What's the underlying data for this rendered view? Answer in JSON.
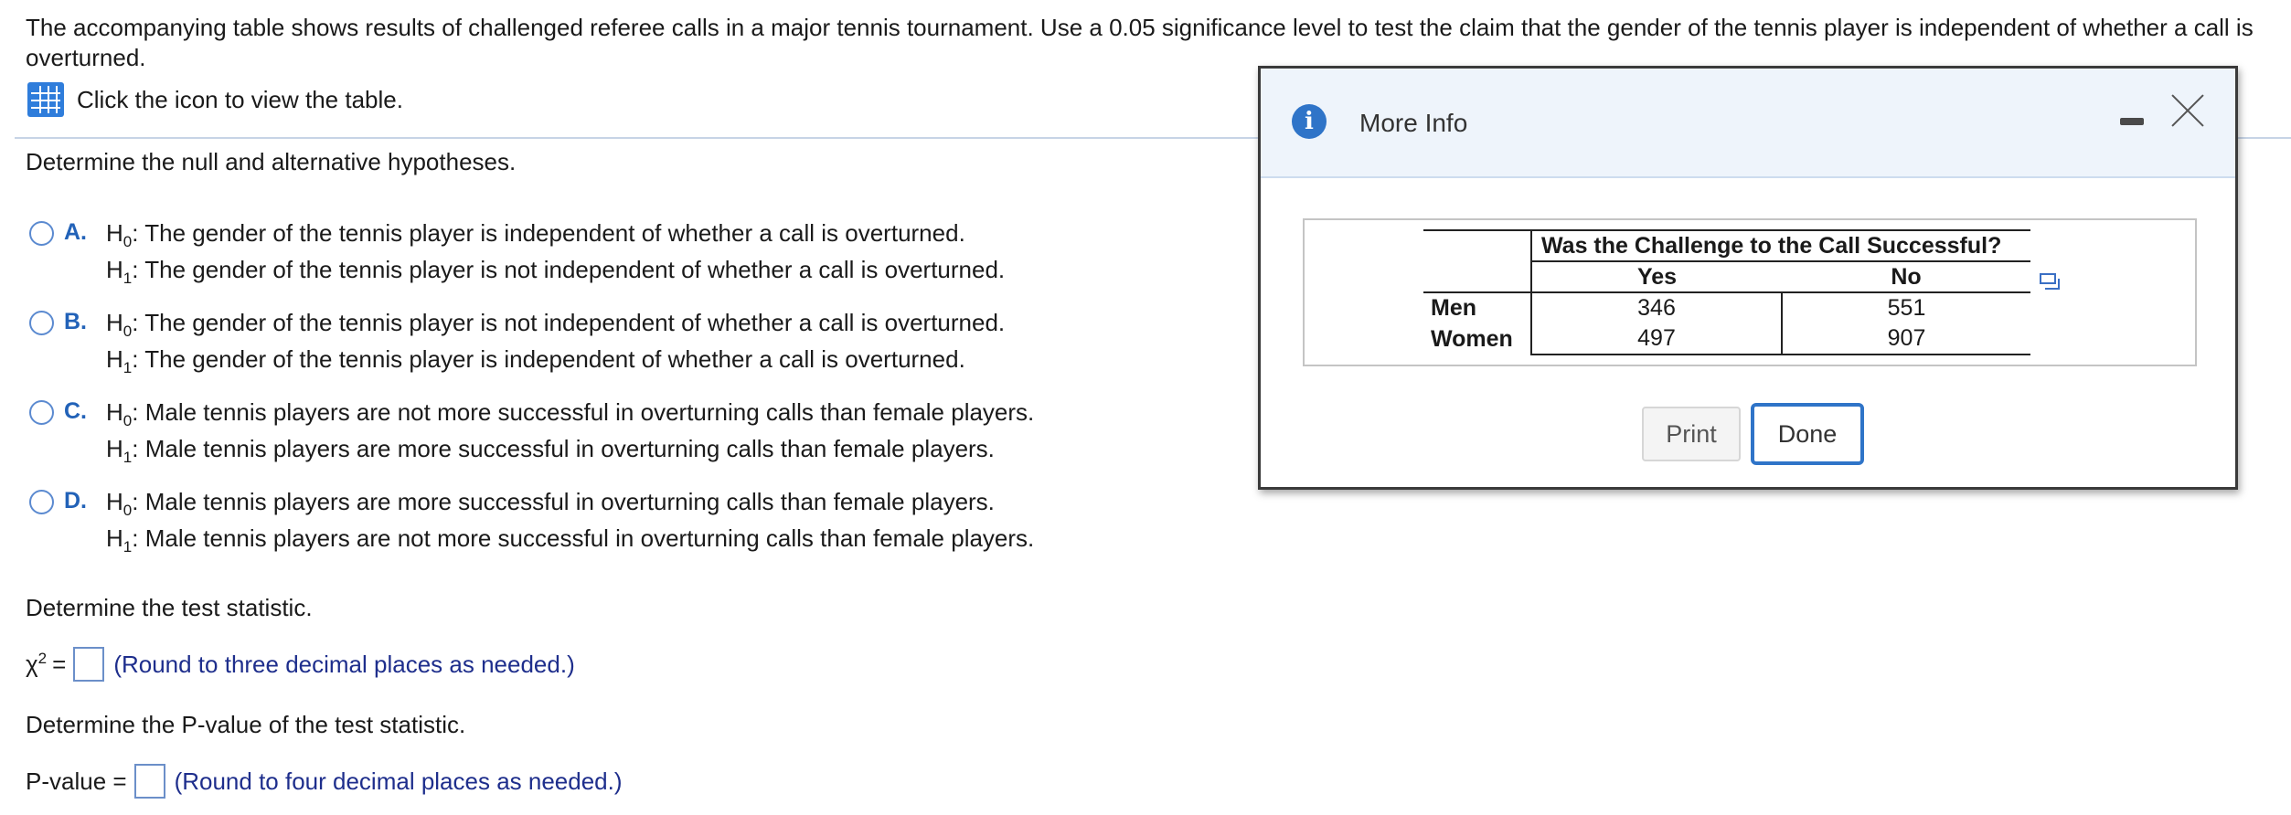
{
  "problem": {
    "text": "The accompanying table shows results of challenged referee calls in a major tennis tournament. Use a 0.05 significance level to test the claim that the gender of the tennis player is independent of whether a call is overturned.",
    "view_table_label": "Click the icon to view the table."
  },
  "hypotheses": {
    "prompt": "Determine the null and alternative hypotheses.",
    "h0_symbol": "H",
    "h0_sub": "0",
    "h1_symbol": "H",
    "h1_sub": "1",
    "options": [
      {
        "letter": "A.",
        "h0": ": The gender of the tennis player is independent of whether a call is overturned.",
        "h1": ": The gender of the tennis player is not independent of whether a call is overturned."
      },
      {
        "letter": "B.",
        "h0": ": The gender of the tennis player is not independent of whether a call is overturned.",
        "h1": ": The gender of the tennis player is independent of whether a call is overturned."
      },
      {
        "letter": "C.",
        "h0": ": Male tennis players are not more successful in overturning calls than female players.",
        "h1": ": Male tennis players are more successful in overturning calls than female players."
      },
      {
        "letter": "D.",
        "h0": ": Male tennis players are more successful in overturning calls than female players.",
        "h1": ": Male tennis players are not more successful in overturning calls than female players."
      }
    ]
  },
  "test_statistic": {
    "prompt": "Determine the test statistic.",
    "symbol": "χ",
    "exponent": "2",
    "equals": "=",
    "value": "",
    "hint": "(Round to three decimal places as needed.)"
  },
  "p_value": {
    "prompt": "Determine the P-value of the test statistic.",
    "label": "P-value =",
    "value": "",
    "hint": "(Round to four decimal places as needed.)"
  },
  "modal": {
    "title": "More Info",
    "info_glyph": "i",
    "table": {
      "header": "Was the Challenge to the Call Successful?",
      "columns": [
        "Yes",
        "No"
      ],
      "rows": [
        {
          "label": "Men",
          "values": [
            "346",
            "551"
          ]
        },
        {
          "label": "Women",
          "values": [
            "497",
            "907"
          ]
        }
      ]
    },
    "print_label": "Print",
    "done_label": "Done"
  },
  "colors": {
    "accent": "#2f74c8",
    "option_letter": "#2262b8",
    "hint_text": "#1e2e8c"
  }
}
